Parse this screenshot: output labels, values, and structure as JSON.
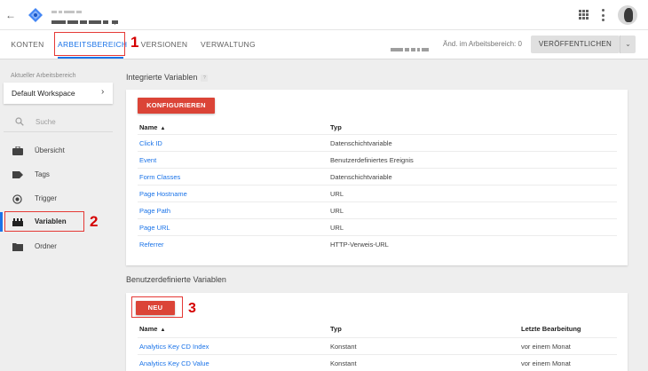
{
  "header": {
    "back_label": "←",
    "avatar_label": "Nutzerkonto"
  },
  "tabs": [
    {
      "label": "KONTEN",
      "active": false
    },
    {
      "label": "ARBEITSBEREICH",
      "active": true
    },
    {
      "label": "VERSIONEN",
      "active": false
    },
    {
      "label": "VERWALTUNG",
      "active": false
    }
  ],
  "toolbar": {
    "changes_text": "Änd. im Arbeitsbereich: 0",
    "publish_label": "VERÖFFENTLICHEN",
    "publish_dropdown_label": "⌄"
  },
  "sidebar": {
    "workspace_label": "Aktueller Arbeitsbereich",
    "workspace_name": "Default Workspace",
    "workspace_chevron": "›",
    "search_placeholder": "Suche",
    "items": [
      {
        "label": "Übersicht",
        "icon": "briefcase-icon",
        "active": false
      },
      {
        "label": "Tags",
        "icon": "tag-icon",
        "active": false
      },
      {
        "label": "Trigger",
        "icon": "trigger-icon",
        "active": false
      },
      {
        "label": "Variablen",
        "icon": "variables-icon",
        "active": true
      },
      {
        "label": "Ordner",
        "icon": "folder-icon",
        "active": false
      }
    ]
  },
  "annotations": {
    "marker_1": "1",
    "marker_2": "2",
    "marker_3": "3"
  },
  "builtin": {
    "title": "Integrierte Variablen",
    "help_label": "?",
    "configure_label": "KONFIGURIEREN",
    "col_name": "Name",
    "col_type": "Typ",
    "sort_indicator": "▲",
    "rows": [
      {
        "name": "Click ID",
        "type": "Datenschichtvariable"
      },
      {
        "name": "Event",
        "type": "Benutzerdefiniertes Ereignis"
      },
      {
        "name": "Form Classes",
        "type": "Datenschichtvariable"
      },
      {
        "name": "Page Hostname",
        "type": "URL"
      },
      {
        "name": "Page Path",
        "type": "URL"
      },
      {
        "name": "Page URL",
        "type": "URL"
      },
      {
        "name": "Referrer",
        "type": "HTTP-Verweis-URL"
      }
    ]
  },
  "custom": {
    "title": "Benutzerdefinierte Variablen",
    "new_label": "NEU",
    "col_name": "Name",
    "col_type": "Typ",
    "col_edited": "Letzte Bearbeitung",
    "sort_indicator": "▲",
    "rows": [
      {
        "name": "Analytics Key CD Index",
        "type": "Konstant",
        "edited": "vor einem Monat"
      },
      {
        "name": "Analytics Key CD Value",
        "type": "Konstant",
        "edited": "vor einem Monat"
      }
    ]
  },
  "colors": {
    "accent": "#1a73e8",
    "action_red": "#db4437",
    "highlight_red": "#e53935"
  }
}
